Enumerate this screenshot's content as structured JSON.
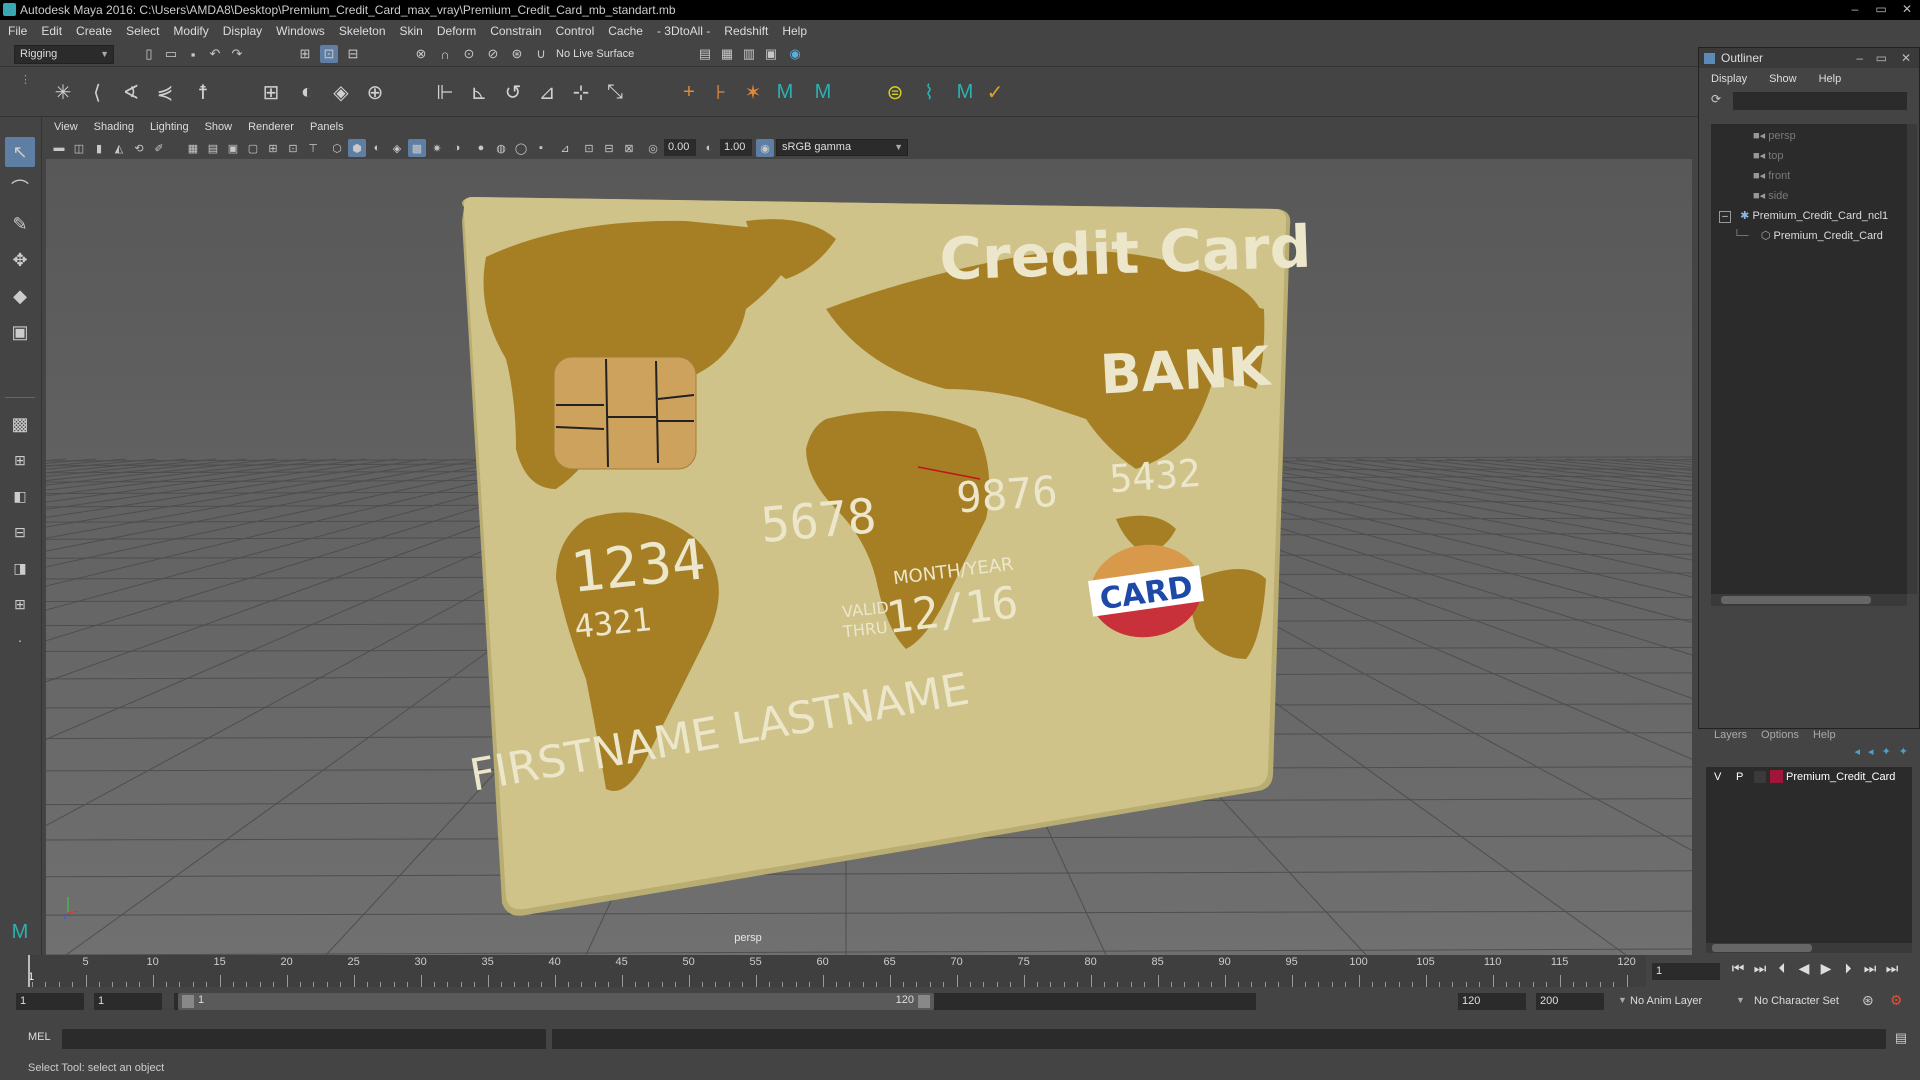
{
  "window": {
    "title": "Autodesk Maya 2016: C:\\Users\\AMDA8\\Desktop\\Premium_Credit_Card_max_vray\\Premium_Credit_Card_mb_standart.mb",
    "controls": [
      "–",
      "▭",
      "✕"
    ]
  },
  "menubar": [
    "File",
    "Edit",
    "Create",
    "Select",
    "Modify",
    "Display",
    "Windows",
    "Skeleton",
    "Skin",
    "Deform",
    "Constrain",
    "Control",
    "Cache",
    "- 3DtoAll -",
    "Redshift",
    "Help"
  ],
  "statusline": {
    "menuset": "Rigging",
    "live_surface": "No Live Surface"
  },
  "panel": {
    "menus": [
      "View",
      "Shading",
      "Lighting",
      "Show",
      "Renderer",
      "Panels"
    ],
    "exposure": "0.00",
    "gamma": "1.00",
    "colorspace": "sRGB gamma",
    "camera_label": "persp"
  },
  "card": {
    "title": "Credit Card",
    "bank": "BANK",
    "number_groups": [
      "1234",
      "5678",
      "9876",
      "5432"
    ],
    "small_number": "4321",
    "valid_thru": "VALID\nTHRU",
    "month_year": "MONTH/YEAR",
    "expiry": "12/16",
    "holder": "FIRSTNAME LASTNAME",
    "logo": "CARD",
    "colors": {
      "base": "#cfc38a",
      "map": "#a67f25",
      "text": "#ece6cb"
    }
  },
  "outliner": {
    "title": "Outliner",
    "menus": [
      "Display",
      "Show",
      "Help"
    ],
    "items": [
      {
        "label": "persp",
        "type": "camera",
        "dim": true
      },
      {
        "label": "top",
        "type": "camera",
        "dim": true
      },
      {
        "label": "front",
        "type": "camera",
        "dim": true
      },
      {
        "label": "side",
        "type": "camera",
        "dim": true
      },
      {
        "label": "Premium_Credit_Card_ncl1",
        "type": "group",
        "dim": false
      },
      {
        "label": "Premium_Credit_Card",
        "type": "mesh",
        "dim": false
      }
    ]
  },
  "layers": {
    "menus": [
      "Layers",
      "Options",
      "Help"
    ],
    "layer": {
      "v": "V",
      "p": "P",
      "name": "Premium_Credit_Card",
      "color": "#a0163a"
    }
  },
  "timeline": {
    "ticks": [
      5,
      10,
      15,
      20,
      25,
      30,
      35,
      40,
      45,
      50,
      55,
      60,
      65,
      70,
      75,
      80,
      85,
      90,
      95,
      100,
      105,
      110,
      115,
      120
    ],
    "start_label": "1",
    "current_frame": "1"
  },
  "range": {
    "start": "1",
    "start_inner": "1",
    "slider_start": "1",
    "slider_end": "120",
    "end_inner": "120",
    "end": "200",
    "anim_layer": "No Anim Layer",
    "character_set": "No Character Set"
  },
  "cmdline": {
    "label": "MEL"
  },
  "helpline": {
    "text": "Select Tool: select an object"
  }
}
